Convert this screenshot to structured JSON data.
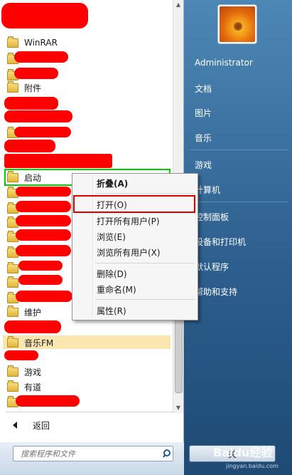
{
  "programs": {
    "items": [
      {
        "label": "WinRAR"
      },
      {
        "label": "附件"
      },
      {
        "label": "启动"
      },
      {
        "label": "维护"
      },
      {
        "label": "音乐FM"
      },
      {
        "label": "游戏"
      },
      {
        "label": "有道"
      }
    ],
    "back_label": "返回"
  },
  "search": {
    "placeholder": "搜索程序和文件"
  },
  "user": {
    "name": "Administrator"
  },
  "right_menu": {
    "items": [
      {
        "label": "文档"
      },
      {
        "label": "图片"
      },
      {
        "label": "音乐"
      },
      {
        "label": "游戏"
      },
      {
        "label": "计算机"
      },
      {
        "label": "控制面板"
      },
      {
        "label": "设备和打印机"
      },
      {
        "label": "默认程序"
      },
      {
        "label": "帮助和支持"
      }
    ],
    "shutdown_label": "关"
  },
  "context_menu": {
    "items": [
      {
        "label": "折叠(A)"
      },
      {
        "label": "打开(O)"
      },
      {
        "label": "打开所有用户(P)"
      },
      {
        "label": "浏览(E)"
      },
      {
        "label": "浏览所有用户(X)"
      },
      {
        "label": "删除(D)"
      },
      {
        "label": "重命名(M)"
      },
      {
        "label": "属性(R)"
      }
    ]
  },
  "watermark": {
    "text": "Baidu经验",
    "subtext": "jingyan.baidu.com"
  },
  "colors": {
    "redaction": "#ff0000",
    "highlight_green": "#00d000",
    "highlight_red": "#e00000",
    "selected_row": "#fbe6b0"
  }
}
